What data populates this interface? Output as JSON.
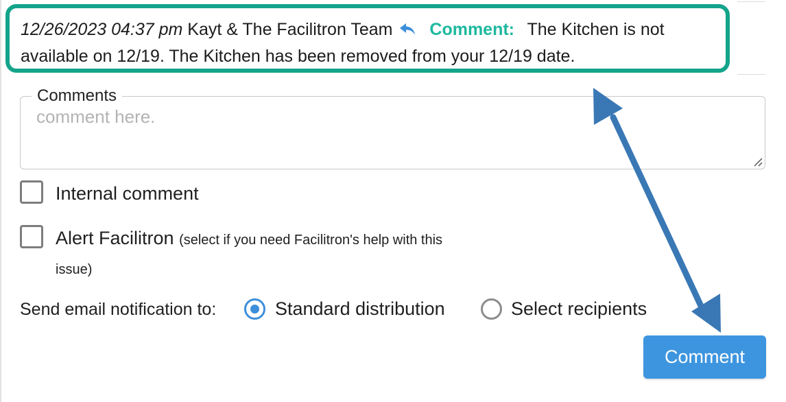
{
  "comment_entry": {
    "date": "12/26/2023 04:37 pm",
    "author": "Kayt & The Facilitron Team",
    "reply_icon": "reply-arrow-icon",
    "label": "Comment:",
    "text": "The Kitchen is not available on 12/19. The Kitchen has been removed from your 12/19 date."
  },
  "comment_form": {
    "legend": "Comments",
    "placeholder": "comment here.",
    "value": "",
    "internal_checkbox": {
      "label": "Internal comment",
      "checked": false
    },
    "alert_checkbox": {
      "label": "Alert Facilitron",
      "hint_line1": "(select if you need Facilitron's help with this",
      "hint_line2": "issue)",
      "checked": false
    },
    "notification": {
      "label": "Send email notification to:",
      "options": [
        {
          "label": "Standard distribution",
          "selected": true
        },
        {
          "label": "Select recipients",
          "selected": false
        }
      ]
    },
    "submit_label": "Comment"
  },
  "annotation": {
    "highlight_color": "#14a38b",
    "arrow_color": "#3a78b5",
    "arrow_icon": "double-headed-arrow"
  },
  "colors": {
    "accent": "#3e95df",
    "comment_label": "#1db89f"
  }
}
